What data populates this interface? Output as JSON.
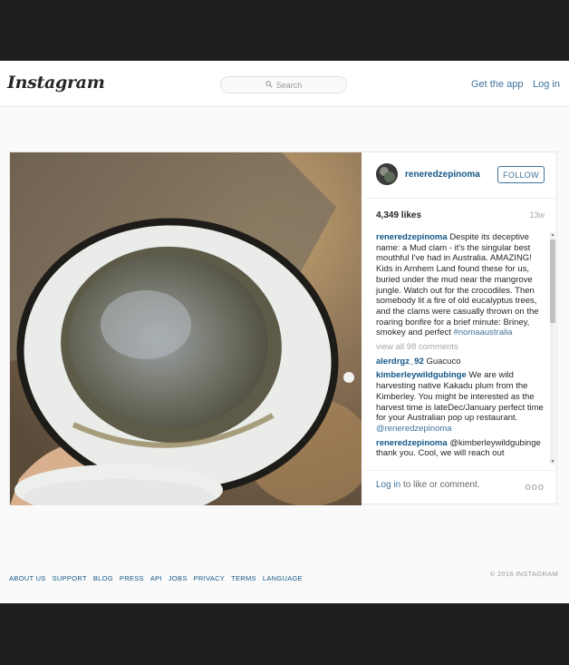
{
  "topbar": {
    "logo": "Instagram",
    "search_placeholder": "Search",
    "get_app": "Get the app",
    "login": "Log in"
  },
  "post": {
    "username": "reneredzepinoma",
    "follow": "FOLLOW",
    "likes": "4,349 likes",
    "age": "13w",
    "caption": {
      "user": "reneredzepinoma",
      "text": "Despite its deceptive name: a Mud clam - it's the singular best mouthful I've had in Australia. AMAZING! Kids in Arnhem Land found these for us, buried under the mud near the mangrove jungle. Watch out for the crocodiles. Then somebody lit a fire of old eucalyptus trees, and the clams were casually thrown on the roaring bonfire for a brief minute: Briney, smokey and perfect",
      "hashtag": "#nomaaustralia"
    },
    "view_all": "view all 98 comments",
    "comments": [
      {
        "user": "alerdrgz_92",
        "text": "Guacuco"
      },
      {
        "user": "kimberleywildgubinge",
        "text": "We are wild harvesting native Kakadu plum from the Kimberley. You might be interested as the harvest time is lateDec/January perfect time for your Australian pop up restaurant.",
        "mention": "@reneredzepinoma"
      },
      {
        "user": "reneredzepinoma",
        "text": "@kimberleywildgubinge thank you. Cool, we will reach out",
        "mention": ""
      }
    ],
    "login_prompt": {
      "login": "Log in",
      "rest": " to like or comment."
    },
    "more": "ooo"
  },
  "footer": {
    "links": [
      "ABOUT US",
      "SUPPORT",
      "BLOG",
      "PRESS",
      "API",
      "JOBS",
      "PRIVACY",
      "TERMS",
      "LANGUAGE"
    ],
    "copyright": "© 2016 INSTAGRAM"
  },
  "colors": {
    "link": "#125688",
    "accent": "#3f729b",
    "muted": "#a5a7aa"
  },
  "icons": [
    "search-icon"
  ]
}
